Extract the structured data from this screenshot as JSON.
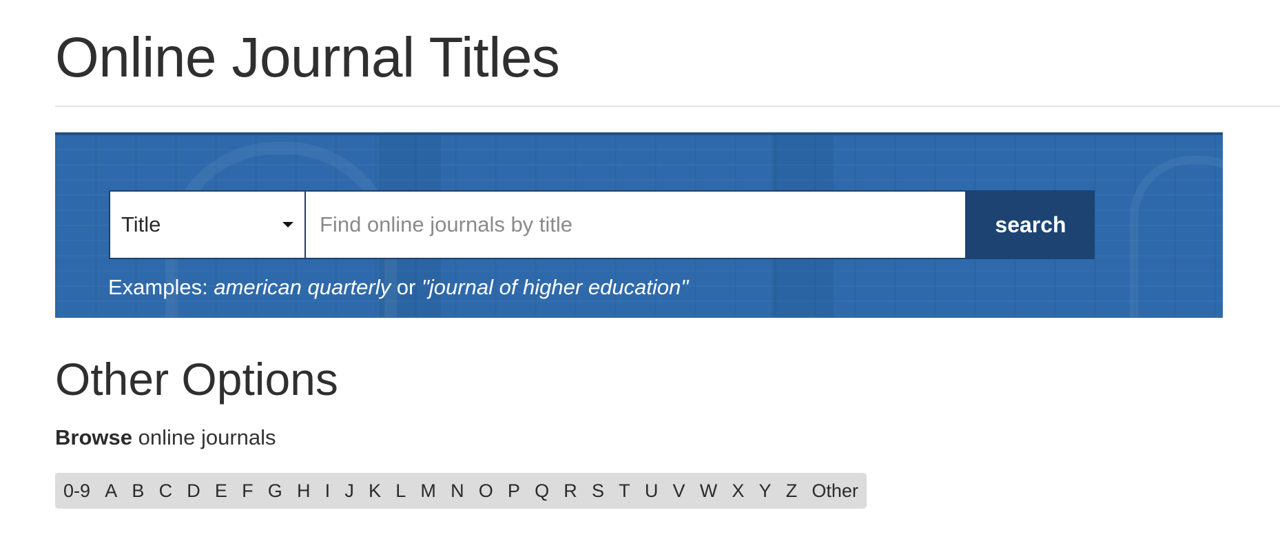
{
  "page": {
    "title": "Online Journal Titles"
  },
  "search": {
    "field_selected": "Title",
    "placeholder": "Find online journals by title",
    "input_value": "",
    "button_label": "search",
    "examples_prefix": "Examples:",
    "example_1": "american quarterly",
    "examples_joiner": "or",
    "example_2": "\"journal of higher education\""
  },
  "other_options": {
    "heading": "Other Options",
    "browse_bold": "Browse",
    "browse_rest": "online journals",
    "letters": [
      "0-9",
      "A",
      "B",
      "C",
      "D",
      "E",
      "F",
      "G",
      "H",
      "I",
      "J",
      "K",
      "L",
      "M",
      "N",
      "O",
      "P",
      "Q",
      "R",
      "S",
      "T",
      "U",
      "V",
      "W",
      "X",
      "Y",
      "Z",
      "Other"
    ]
  },
  "colors": {
    "panel_background": "#2e6aab",
    "search_button": "#1d4373",
    "browse_bar": "#dcdcdc"
  },
  "icons": {
    "field_select": "caret-down-icon"
  }
}
